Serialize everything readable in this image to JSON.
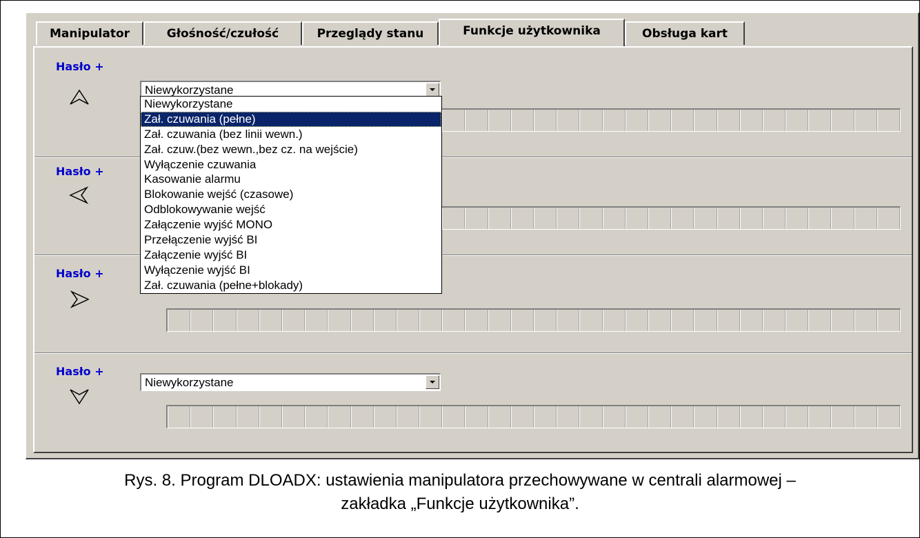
{
  "tabs": [
    {
      "label": "Manipulator"
    },
    {
      "label": "Głośność/czułość"
    },
    {
      "label": "Przeglądy stanu"
    },
    {
      "label": "Funkcje użytkownika"
    },
    {
      "label": "Obsługa kart"
    }
  ],
  "active_tab": "Funkcje użytkownika",
  "rows": [
    {
      "label": "Hasło +",
      "arrow": "arrow-up-icon",
      "value": "Niewykorzystane"
    },
    {
      "label": "Hasło +",
      "arrow": "arrow-left-icon",
      "value": ""
    },
    {
      "label": "Hasło +",
      "arrow": "arrow-right-icon",
      "value": ""
    },
    {
      "label": "Hasło +",
      "arrow": "arrow-down-icon",
      "value": "Niewykorzystane"
    }
  ],
  "dropdown": {
    "selected_index": 1,
    "options": [
      "Niewykorzystane",
      "Zał. czuwania (pełne)",
      "Zał. czuwania (bez linii wewn.)",
      "Zał. czuw.(bez wewn.,bez cz. na wejście)",
      "Wyłączenie czuwania",
      "Kasowanie alarmu",
      "Blokowanie wejść (czasowe)",
      "Odblokowywanie wejść",
      "Załączenie wyjść MONO",
      "Przełączenie wyjść BI",
      "Załączenie wyjść BI",
      "Wyłączenie wyjść BI",
      "Zał. czuwania (pełne+blokady)"
    ]
  },
  "caption": {
    "line1": "Rys. 8. Program DLOADX: ustawienia manipulatora przechowywane w centrali alarmowej –",
    "line2": "zakładka „Funkcje użytkownika”."
  },
  "colors": {
    "label_blue": "#0000cc",
    "selection": "#0a246a",
    "window_face": "#d4d0c8"
  }
}
